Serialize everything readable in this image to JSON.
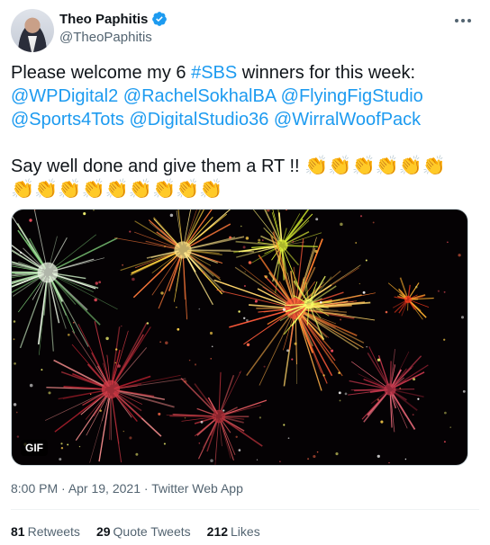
{
  "author": {
    "display_name": "Theo Paphitis",
    "handle": "@TheoPaphitis",
    "verified": true
  },
  "tweet": {
    "line1_prefix": "Please welcome my 6 ",
    "line1_hashtag": "#SBS",
    "line1_suffix": " winners for this week:",
    "mentions_row1": [
      "@WPDigital2",
      "@RachelSokhalBA",
      "@FlyingFigStudio"
    ],
    "mentions_row2": [
      "@Sports4Tots",
      "@DigitalStudio36",
      "@WirralWoofPack"
    ],
    "line3": "Say well done and give them a RT !! ",
    "clap_emoji": "👏",
    "claps_row1": 6,
    "claps_row2": 9
  },
  "media": {
    "type": "gif",
    "badge": "GIF",
    "subject": "fireworks"
  },
  "meta": {
    "time": "8:00 PM",
    "separator": " · ",
    "date": "Apr 19, 2021",
    "source": "Twitter Web App"
  },
  "stats": {
    "retweets_count": "81",
    "retweets_label": "Retweets",
    "quotes_count": "29",
    "quotes_label": "Quote Tweets",
    "likes_count": "212",
    "likes_label": "Likes"
  },
  "colors": {
    "link": "#1d9bf0",
    "text": "#0f1419",
    "secondary": "#536471"
  }
}
